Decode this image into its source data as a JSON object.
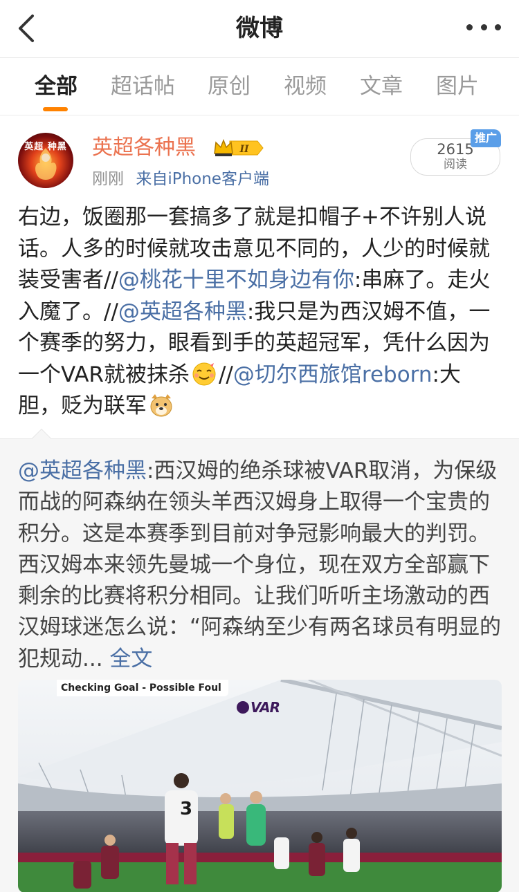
{
  "navbar": {
    "title": "微博"
  },
  "tabs": [
    {
      "label": "全部",
      "active": true
    },
    {
      "label": "超话帖",
      "active": false
    },
    {
      "label": "原创",
      "active": false
    },
    {
      "label": "视频",
      "active": false
    },
    {
      "label": "文章",
      "active": false
    },
    {
      "label": "图片",
      "active": false
    }
  ],
  "post": {
    "avatar_text": "英超 种黑",
    "author": "英超各种黑",
    "badge_level": "II",
    "time": "刚刚",
    "source_prefix": "来自",
    "source": "iPhone客户端",
    "reads_count": "2615",
    "reads_label": "阅读",
    "promo_label": "推广",
    "text": {
      "part1": "右边，饭圈那一套搞多了就是扣帽子+不许别人说话。人多的时候就攻击意见不同的，人少的时候就装受害者//",
      "mention1": "@桃花十里不如身边有你",
      "part2": ":串麻了。走火入魔了。//",
      "mention2": "@英超各种黑",
      "part3": ":我只是为西汉姆不值，一个赛季的努力，眼看到手的英超冠军，凭什么因为一个VAR就被抹杀",
      "part4": "//",
      "mention3": "@切尔西旅馆reborn",
      "part5": ":大胆，贬为联军"
    },
    "emojis": [
      "smiling-face-emoji",
      "doge-emoji"
    ]
  },
  "retweet": {
    "mention": "@英超各种黑",
    "text": ":西汉姆的绝杀球被VAR取消，为保级而战的阿森纳在领头羊西汉姆身上取得一个宝贵的积分。这是本赛季到目前对争冠影响最大的判罚。西汉姆本来领先曼城一个身位，现在双方全部赢下剩余的比赛将积分相同。让我们听听主场激动的西汉姆球迷怎么说：“阿森纳至少有两名球员有明显的犯规动...",
    "more_label": "全文",
    "media": {
      "overlay_label": "Checking Goal - Possible Foul",
      "logo_text": "VAR",
      "shirt_number": "3"
    }
  },
  "colors": {
    "accent_orange": "#ff8200",
    "author_orange": "#eb7350",
    "link_blue": "#4a6fa5",
    "retweet_bg": "#f6f6f6",
    "promo_blue": "#5a9ee8"
  }
}
